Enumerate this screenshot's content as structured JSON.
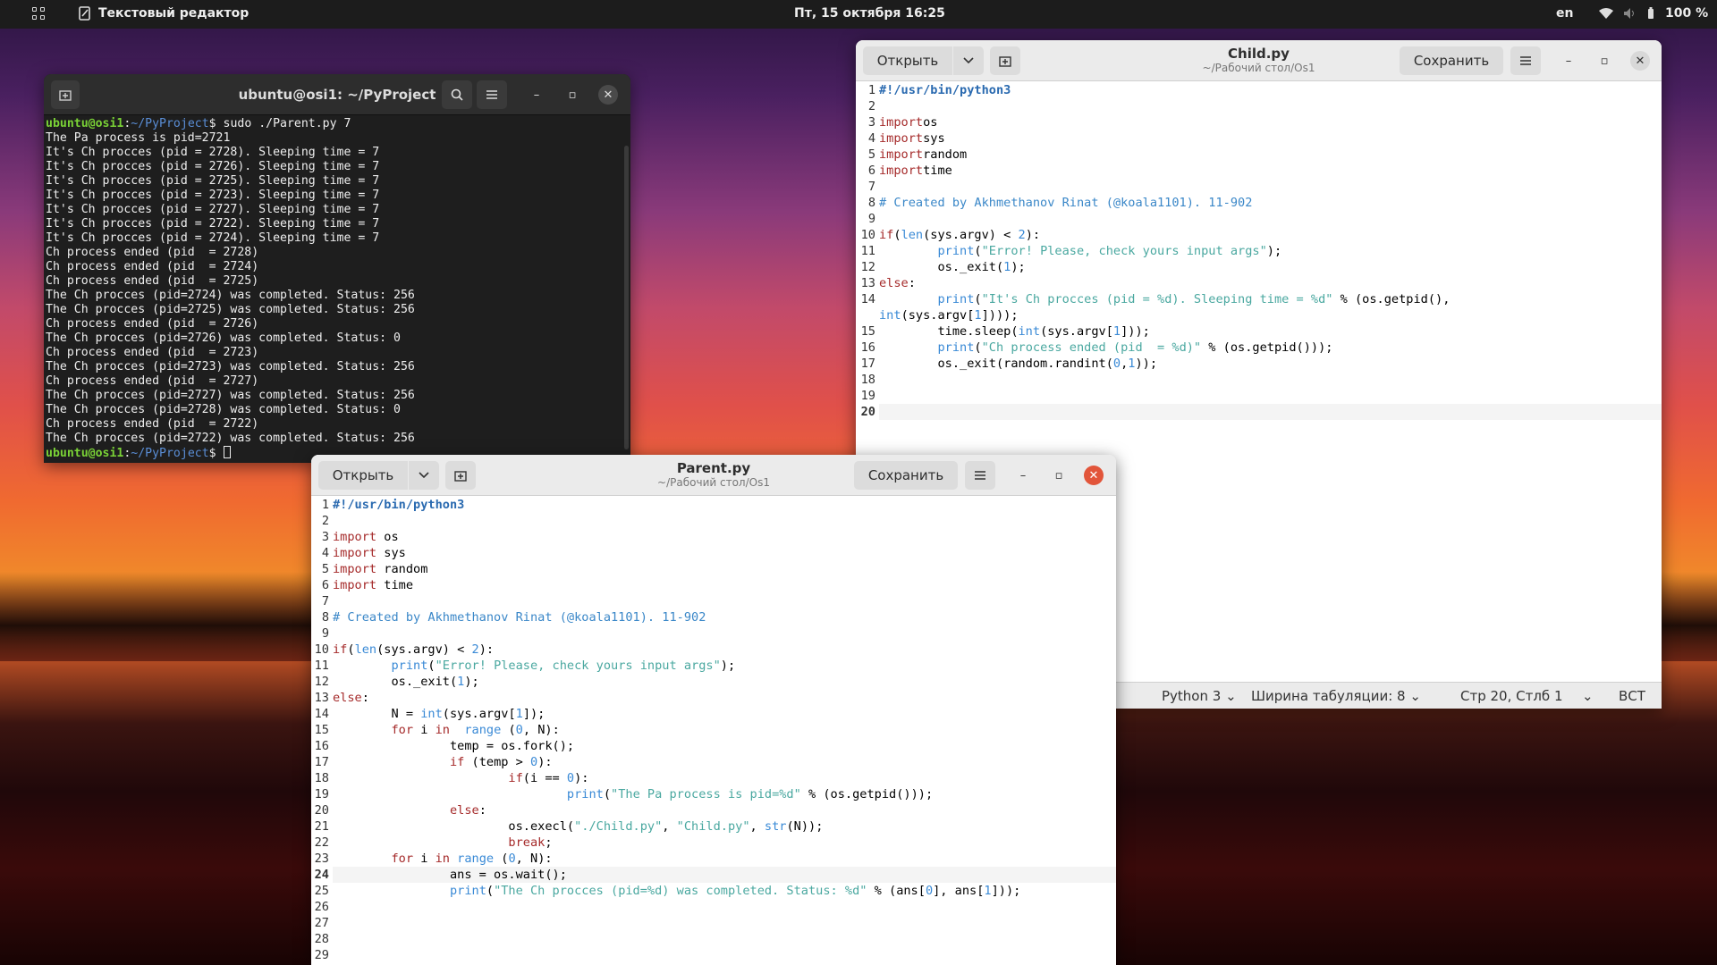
{
  "topbar": {
    "app_name": "Текстовый редактор",
    "clock": "Пт, 15 октября  16:25",
    "lang": "en",
    "battery": "100 %"
  },
  "terminal": {
    "title": "ubuntu@osi1: ~/PyProject",
    "prompt_user": "ubuntu@osi1",
    "prompt_path": "~/PyProject",
    "command": "$ sudo ./Parent.py 7",
    "output": [
      "The Pa process is pid=2721",
      "It's Ch procces (pid = 2728). Sleeping time = 7",
      "It's Ch procces (pid = 2726). Sleeping time = 7",
      "It's Ch procces (pid = 2725). Sleeping time = 7",
      "It's Ch procces (pid = 2723). Sleeping time = 7",
      "It's Ch procces (pid = 2727). Sleeping time = 7",
      "It's Ch procces (pid = 2722). Sleeping time = 7",
      "It's Ch procces (pid = 2724). Sleeping time = 7",
      "Ch process ended (pid  = 2728)",
      "Ch process ended (pid  = 2724)",
      "Ch process ended (pid  = 2725)",
      "The Ch procces (pid=2724) was completed. Status: 256",
      "The Ch procces (pid=2725) was completed. Status: 256",
      "Ch process ended (pid  = 2726)",
      "The Ch procces (pid=2726) was completed. Status: 0",
      "Ch process ended (pid  = 2723)",
      "The Ch procces (pid=2723) was completed. Status: 256",
      "Ch process ended (pid  = 2727)",
      "The Ch procces (pid=2727) was completed. Status: 256",
      "The Ch procces (pid=2728) was completed. Status: 0",
      "Ch process ended (pid  = 2722)",
      "The Ch procces (pid=2722) was completed. Status: 256"
    ],
    "last_prompt_suffix": "$ "
  },
  "child": {
    "title": "Child.py",
    "path": "~/Рабочий стол/Os1",
    "open_label": "Открыть",
    "save_label": "Сохранить",
    "status": {
      "lang": "Python 3",
      "tab": "Ширина табуляции: 8",
      "pos": "Стр 20, Стлб 1",
      "mode": "ВСТ"
    },
    "line_numbers": [
      "1",
      "2",
      "3",
      "4",
      "5",
      "6",
      "7",
      "8",
      "9",
      "10",
      "11",
      "12",
      "13",
      "14",
      "",
      "15",
      "16",
      "17",
      "18",
      "19",
      "20"
    ],
    "lines": [
      [
        [
          "sb",
          "#!/usr/bin/python3"
        ]
      ],
      [],
      [
        [
          "kw",
          "import"
        ],
        [
          "",
          "os"
        ]
      ],
      [
        [
          "kw",
          "import"
        ],
        [
          "",
          "sys"
        ]
      ],
      [
        [
          "kw",
          "import"
        ],
        [
          "",
          "random"
        ]
      ],
      [
        [
          "kw",
          "import"
        ],
        [
          "",
          "time"
        ]
      ],
      [],
      [
        [
          "cm",
          "# Created by Akhmethanov Rinat (@koala1101). 11-902"
        ]
      ],
      [],
      [
        [
          "kw",
          "if"
        ],
        [
          "",
          "("
        ],
        [
          "bi",
          "len"
        ],
        [
          "",
          "(sys.argv) < "
        ],
        [
          "nu",
          "2"
        ],
        [
          "",
          "):"
        ]
      ],
      [
        [
          "",
          "        "
        ],
        [
          "bi",
          "print"
        ],
        [
          "",
          "("
        ],
        [
          "st",
          "\"Error! Please, check yours input args\""
        ],
        [
          "",
          ");"
        ]
      ],
      [
        [
          "",
          "        os._exit("
        ],
        [
          "nu",
          "1"
        ],
        [
          "",
          ");"
        ]
      ],
      [
        [
          "kw",
          "else"
        ],
        [
          "",
          ":"
        ]
      ],
      [
        [
          "",
          "        "
        ],
        [
          "bi",
          "print"
        ],
        [
          "",
          "("
        ],
        [
          "st",
          "\"It's Ch procces (pid = %d). Sleeping time = %d\""
        ],
        [
          "",
          " % (os.getpid(),"
        ]
      ],
      [
        [
          "bi",
          "int"
        ],
        [
          "",
          "(sys.argv["
        ],
        [
          "nu",
          "1"
        ],
        [
          "",
          "])));"
        ]
      ],
      [
        [
          "",
          "        time.sleep("
        ],
        [
          "bi",
          "int"
        ],
        [
          "",
          "(sys.argv["
        ],
        [
          "nu",
          "1"
        ],
        [
          "",
          "]));"
        ]
      ],
      [
        [
          "",
          "        "
        ],
        [
          "bi",
          "print"
        ],
        [
          "",
          "("
        ],
        [
          "st",
          "\"Ch process ended (pid  = %d)\""
        ],
        [
          "",
          " % (os.getpid()));"
        ]
      ],
      [
        [
          "",
          "        os._exit(random.randint("
        ],
        [
          "nu",
          "0"
        ],
        [
          "",
          ","
        ],
        [
          "nu",
          "1"
        ],
        [
          "",
          "));"
        ]
      ],
      [],
      [],
      []
    ]
  },
  "parent": {
    "title": "Parent.py",
    "path": "~/Рабочий стол/Os1",
    "open_label": "Открыть",
    "save_label": "Сохранить",
    "line_numbers": [
      "1",
      "2",
      "3",
      "4",
      "5",
      "6",
      "7",
      "8",
      "9",
      "10",
      "11",
      "12",
      "13",
      "14",
      "15",
      "16",
      "17",
      "18",
      "19",
      "20",
      "21",
      "22",
      "23",
      "24",
      "25",
      "26",
      "27",
      "28",
      "29"
    ],
    "lines": [
      [
        [
          "sb",
          "#!/usr/bin/python3"
        ]
      ],
      [],
      [
        [
          "kw",
          "import"
        ],
        [
          "",
          " os"
        ]
      ],
      [
        [
          "kw",
          "import"
        ],
        [
          "",
          " sys"
        ]
      ],
      [
        [
          "kw",
          "import"
        ],
        [
          "",
          " random"
        ]
      ],
      [
        [
          "kw",
          "import"
        ],
        [
          "",
          " time"
        ]
      ],
      [],
      [
        [
          "cm",
          "# Created by Akhmethanov Rinat (@koala1101). 11-902"
        ]
      ],
      [],
      [
        [
          "kw",
          "if"
        ],
        [
          "",
          "("
        ],
        [
          "bi",
          "len"
        ],
        [
          "",
          "(sys.argv) < "
        ],
        [
          "nu",
          "2"
        ],
        [
          "",
          "):"
        ]
      ],
      [
        [
          "",
          "        "
        ],
        [
          "bi",
          "print"
        ],
        [
          "",
          "("
        ],
        [
          "st",
          "\"Error! Please, check yours input args\""
        ],
        [
          "",
          ");"
        ]
      ],
      [
        [
          "",
          "        os._exit("
        ],
        [
          "nu",
          "1"
        ],
        [
          "",
          ");"
        ]
      ],
      [
        [
          "kw",
          "else"
        ],
        [
          "",
          ":"
        ]
      ],
      [
        [
          "",
          "        N = "
        ],
        [
          "bi",
          "int"
        ],
        [
          "",
          "(sys.argv["
        ],
        [
          "nu",
          "1"
        ],
        [
          "",
          "]);"
        ]
      ],
      [
        [
          "",
          "        "
        ],
        [
          "kw",
          "for"
        ],
        [
          "",
          " i "
        ],
        [
          "kw",
          "in"
        ],
        [
          "",
          "  "
        ],
        [
          "bi",
          "range"
        ],
        [
          "",
          " ("
        ],
        [
          "nu",
          "0"
        ],
        [
          "",
          ", N):"
        ]
      ],
      [
        [
          "",
          "                temp = os.fork();"
        ]
      ],
      [
        [
          "",
          "                "
        ],
        [
          "kw",
          "if"
        ],
        [
          "",
          " (temp > "
        ],
        [
          "nu",
          "0"
        ],
        [
          "",
          "):"
        ]
      ],
      [
        [
          "",
          "                        "
        ],
        [
          "kw",
          "if"
        ],
        [
          "",
          "(i == "
        ],
        [
          "nu",
          "0"
        ],
        [
          "",
          "):"
        ]
      ],
      [
        [
          "",
          "                                "
        ],
        [
          "bi",
          "print"
        ],
        [
          "",
          "("
        ],
        [
          "st",
          "\"The Pa process is pid=%d\""
        ],
        [
          "",
          " % (os.getpid()));"
        ]
      ],
      [
        [
          "",
          "                "
        ],
        [
          "kw",
          "else"
        ],
        [
          "",
          ":"
        ]
      ],
      [
        [
          "",
          "                        os.execl("
        ],
        [
          "st",
          "\"./Child.py\""
        ],
        [
          "",
          ", "
        ],
        [
          "st",
          "\"Child.py\""
        ],
        [
          "",
          ", "
        ],
        [
          "bi",
          "str"
        ],
        [
          "",
          "(N));"
        ]
      ],
      [
        [
          "",
          "                        "
        ],
        [
          "kw",
          "break"
        ],
        [
          "",
          ";"
        ]
      ],
      [
        [
          "",
          "        "
        ],
        [
          "kw",
          "for"
        ],
        [
          "",
          " i "
        ],
        [
          "kw",
          "in"
        ],
        [
          "",
          " "
        ],
        [
          "bi",
          "range"
        ],
        [
          "",
          " ("
        ],
        [
          "nu",
          "0"
        ],
        [
          "",
          ", N):"
        ]
      ],
      [
        [
          "",
          "                ans = os.wait();"
        ]
      ],
      [
        [
          "",
          "                "
        ],
        [
          "bi",
          "print"
        ],
        [
          "",
          "("
        ],
        [
          "st",
          "\"The Ch procces (pid=%d) was completed. Status: %d\""
        ],
        [
          "",
          " % (ans["
        ],
        [
          "nu",
          "0"
        ],
        [
          "",
          "], ans["
        ],
        [
          "nu",
          "1"
        ],
        [
          "",
          "]));"
        ]
      ],
      [],
      [],
      [],
      []
    ]
  }
}
